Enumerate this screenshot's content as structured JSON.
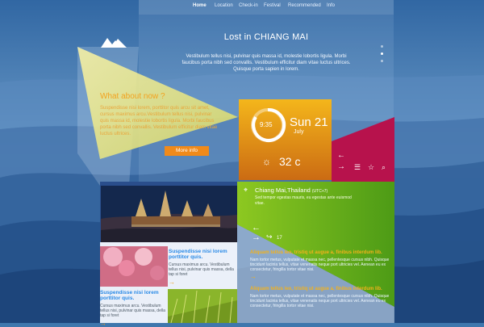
{
  "colors": {
    "nav_active": "#ffffff",
    "accent_orange": "#f08a1a",
    "accent_blue": "#2a8ae6",
    "accent_magenta": "#b4124a",
    "accent_green": "#7cbe1b"
  },
  "nav": {
    "items": [
      {
        "label": "Home",
        "active": true
      },
      {
        "label": "Location"
      },
      {
        "label": "Check-in"
      },
      {
        "label": "Festival"
      },
      {
        "label": "Recommended"
      },
      {
        "label": "Info"
      }
    ]
  },
  "hero": {
    "title": "Lost in CHIANG MAI",
    "text": "Vestibulum tellus nisi, pulvinar quis massa id, molestie lobortis ligula. Morbi faucibus porta nibh sed convallis. Vestibulum efficitur diam vitae luctus ultrices. Quisque porta sapien in lorem."
  },
  "about": {
    "title": "What about now ?",
    "text": "Suspendisse nisi lorem, porttitor quis arcu sit amet, cursus maximus arcu.Vestibulum tellus nisi, pulvinar quis massa id, molestie lobortis ligula. Morbi faucibus porta nibh sed convallis. Vestibulum efficitur diam vitae luctus ultrices.",
    "button": "More info"
  },
  "weather": {
    "time": "9:35",
    "day": "Sun 21",
    "month": "July",
    "temp": "32 c",
    "icons": [
      "sun-icon",
      "timer-ring-icon"
    ]
  },
  "side_panel": {
    "icons": [
      "arrow-left-icon",
      "arrow-right-icon",
      "menu-icon",
      "star-icon",
      "search-icon"
    ]
  },
  "location": {
    "title": "Chiang Mai,Thailand",
    "detail": "(UTC+7)",
    "text": "Sed tempor egestas mauris, eu egestas ante euismod vitae."
  },
  "gallery": {
    "left_text_blocks": [
      {
        "title": "Suspendisse nisi lorem porttitor quis.",
        "text": "Cursus maximus arcu. Vestibulum tellus nisi, pulvinar quis massa, della tap si foret"
      },
      {
        "title": "Suspendisse nisi lorem porttitor quis.",
        "text": "Cursus maximus arcu. Vestibulum tellus nisi, pulvinar quis massa, della tap si foret"
      }
    ]
  },
  "news": [
    {
      "title": "Aliquam tellus leo, tristiq ut augue a, finibus interdum lib.",
      "text": "Nam tortor metus, vulputate et massa nec, pellentesque cursus nibh. Quisque tincidunt lacinia tellus, vitae venenatis neque port ultricies vel. Aenean eu ex consectetur, fringilla tortor vitae nisi."
    },
    {
      "title": "Aliquam tellus leo, tristiq ut augue a, finibus interdum lib.",
      "text": "Nam tortor metus, vulputate et massa nec, pellentesque cursus nibh. Quisque tincidunt lacinia tellus, vitae venenatis neque port ultricies vel. Aenean eu ex consectetur, fringilla tortor vitae nisi."
    }
  ],
  "arrows": {
    "left": "←",
    "right": "→",
    "share_count": "17"
  }
}
